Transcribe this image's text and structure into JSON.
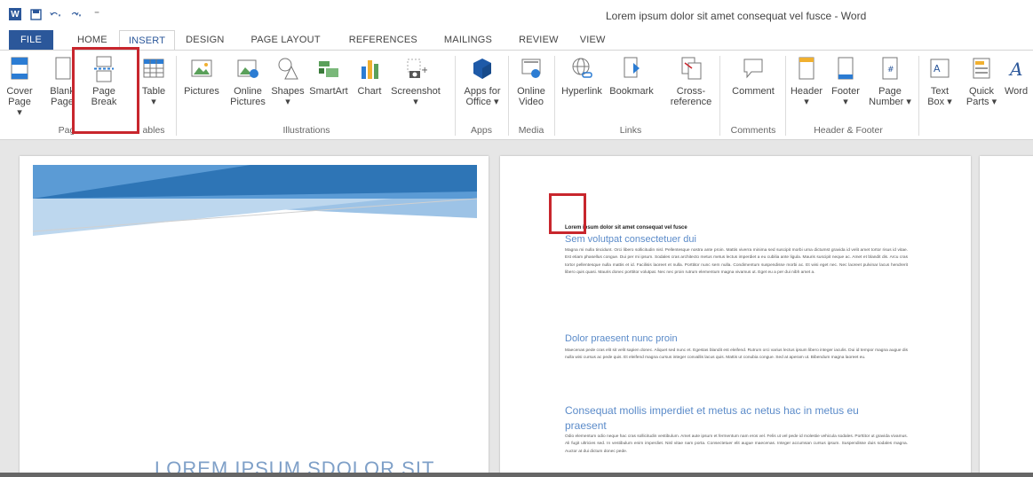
{
  "window": {
    "title": "Lorem ipsum dolor sit amet consequat vel fusce - Word"
  },
  "qat": {
    "undo_icon": "undo-icon",
    "redo_icon": "redo-icon",
    "customize": "⁼"
  },
  "tabs": [
    {
      "label": "FILE"
    },
    {
      "label": "HOME"
    },
    {
      "label": "INSERT"
    },
    {
      "label": "DESIGN"
    },
    {
      "label": "PAGE LAYOUT"
    },
    {
      "label": "REFERENCES"
    },
    {
      "label": "MAILINGS"
    },
    {
      "label": "REVIEW"
    },
    {
      "label": "VIEW"
    }
  ],
  "ribbon": {
    "cover_page": [
      "Cover",
      "Page ▾"
    ],
    "blank_page": [
      "Blank",
      "Page"
    ],
    "page_break": [
      "Page",
      "Break"
    ],
    "table": [
      "Table",
      "▾"
    ],
    "pictures": [
      "Pictures"
    ],
    "online_pictures": [
      "Online",
      "Pictures"
    ],
    "shapes": [
      "Shapes",
      "▾"
    ],
    "smartart": [
      "SmartArt"
    ],
    "chart": [
      "Chart"
    ],
    "screenshot": [
      "Screenshot",
      "▾"
    ],
    "apps_for_office": [
      "Apps for",
      "Office ▾"
    ],
    "online_video": [
      "Online",
      "Video"
    ],
    "hyperlink": [
      "Hyperlink"
    ],
    "bookmark": [
      "Bookmark"
    ],
    "cross_reference": [
      "Cross-",
      "reference"
    ],
    "comment": [
      "Comment"
    ],
    "header": [
      "Header",
      "▾"
    ],
    "footer": [
      "Footer",
      "▾"
    ],
    "page_number": [
      "Page",
      "Number ▾"
    ],
    "text_box": [
      "Text",
      "Box ▾"
    ],
    "quick_parts": [
      "Quick",
      "Parts ▾"
    ],
    "wordart": [
      "Word"
    ],
    "groups": {
      "pages": "Pag",
      "tables": "ables",
      "illustrations": "Illustrations",
      "apps": "Apps",
      "media": "Media",
      "links": "Links",
      "comments": "Comments",
      "header_footer": "Header & Footer"
    }
  },
  "document": {
    "cover_title": "LOREM IPSUM SDOLOR SIT",
    "title": "Lorem ipsum dolor sit amet consequat vel fusce",
    "heading1": "Sem volutpat consectetuer dui",
    "para1": "Magna mi nulla tincidunt. Orci libero sollicitudin nisl. Pellentesque nostra ante proin. Mattis viverra minima sed suscipit morbi urna dictumst gravida id velit amet tortor risus id vitae. Est etiam phasellus congue. Dui per mi ipsum. Sodales cras architecto metus metus lectus imperdiet a eu cubilia ante ligula. Mauris suscipit neque ac. Amet et blandit dis. Arcu cras tortor pellentesque nulla mattis et id. Facilisis laoreet et nulla. Porttitor nunc sem nulla. Condimentum suspendisse morbi ac. Et wisi eget nec. Nec laoreet pulvinar lacus hendrerit libero quis quasi. Mauris donec porttitor volutpat. Nec nec proin rutrum elementum magna vivamus ut. Eget eu a per dui nibh amet a.",
    "heading2": "Dolor praesent nunc proin",
    "para2": "Maecenas pede cras elit sit velit sapien donec. Aliquet sed nunc et. Egestas blandit est eleifend. Rutrum orci varius lectus ipsum libero integer iaculis. Dui id tempor magna augue dis nulla wisi cursus ac pede quis. Et eleifend magna cursus integer convallis lacus quis. Mattis ut conubia congue. Sed at aperam ut. Bibendum magna laoreet eu.",
    "heading3a": "Consequat mollis imperdiet et metus ac netus hac in metus eu",
    "heading3b": "praesent",
    "para3": "Odio elementum odio neque hac cras sollicitudin vestibulum. Amet aute ipsum et fermentum nam eros vel. Felis ut vel pede id molestie vehicula sodales. Porttitor ut gravida vivamus. Ali fugit ultricies sed. In vestibulum enim imperdiet. Nisl vitae nam porta. Consectetuer elit augue maecenas. Integer accumsan cursus ipsum. Suspendisse duis sodales magna. Auctor at dui dictum donec pede."
  },
  "colors": {
    "accent": "#2b579a",
    "highlight": "#c8262d",
    "heading": "#5b8bc9"
  }
}
